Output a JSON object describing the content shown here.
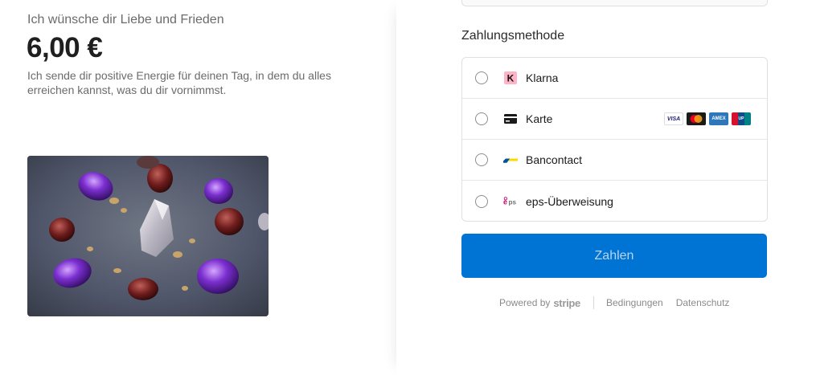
{
  "product": {
    "name": "Ich wünsche dir Liebe und Frieden",
    "price": "6,00 €",
    "description": "Ich sende dir positive Energie für deinen Tag, in dem du alles erreichen kannst, was du dir vornimmst."
  },
  "payment": {
    "section_title": "Zahlungsmethode",
    "methods": [
      {
        "label": "Klarna",
        "icon": "klarna-icon"
      },
      {
        "label": "Karte",
        "icon": "card-icon",
        "brands": [
          "VISA",
          "Mastercard",
          "AMEX",
          "UnionPay"
        ]
      },
      {
        "label": "Bancontact",
        "icon": "bancontact-icon"
      },
      {
        "label": "eps-Überweisung",
        "icon": "eps-icon"
      }
    ],
    "pay_button": "Zahlen"
  },
  "footer": {
    "powered_by": "Powered by",
    "brand": "stripe",
    "links": [
      "Bedingungen",
      "Datenschutz"
    ]
  },
  "colors": {
    "pay_button": "#0074d4",
    "klarna": "#ffb3c7",
    "mastercard_red": "#eb001b",
    "mastercard_yellow": "#f79e1b",
    "amex": "#2e77bb",
    "bancontact_blue": "#005498",
    "bancontact_yellow": "#ffd800",
    "eps": "#c8036f"
  }
}
